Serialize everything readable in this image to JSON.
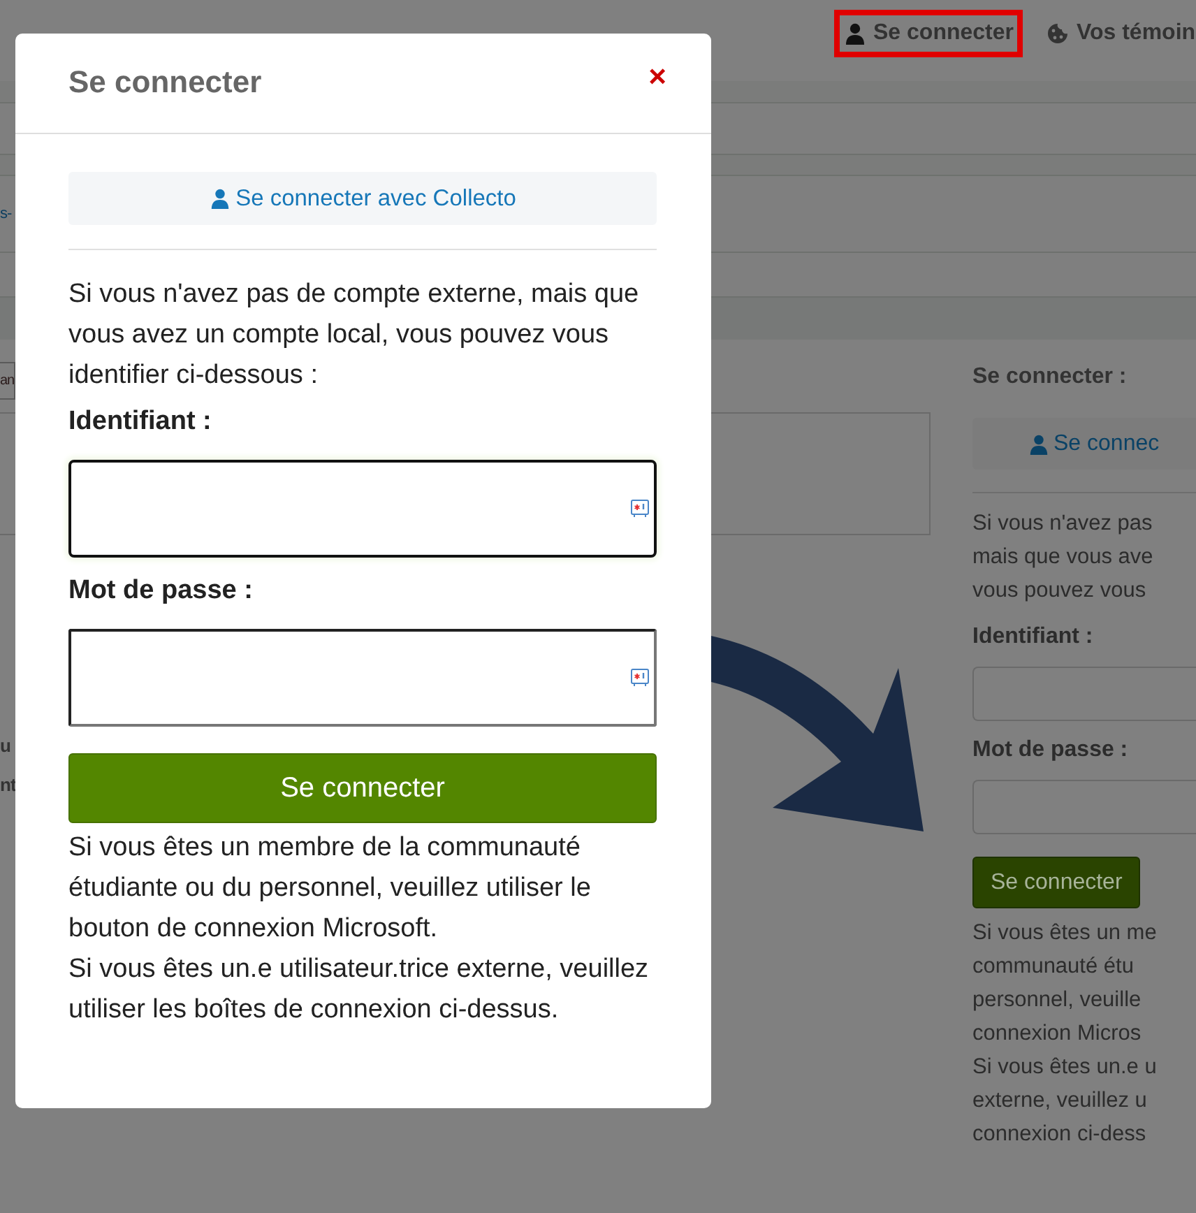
{
  "header": {
    "links": [
      {
        "label": "Se connecter",
        "kind": "account",
        "highlighted": true
      },
      {
        "label": "Vos témoin",
        "kind": "cookies",
        "highlighted": false
      }
    ]
  },
  "background": {
    "fragments": [
      "s-",
      "an",
      "u",
      "nt"
    ]
  },
  "sidebar": {
    "title": "Se connecter :",
    "sso_button": "Se connec",
    "intro_lines": [
      "Si vous n'avez pas",
      "mais que vous ave",
      "vous pouvez vous"
    ],
    "fields": [
      {
        "label": "Identifiant :"
      },
      {
        "label": "Mot de passe :"
      }
    ],
    "submit": "Se connecter",
    "help_lines": [
      "Si vous êtes un me",
      "communauté étu",
      "personnel, veuille",
      "connexion Micros",
      "Si vous êtes un.e u",
      "externe, veuillez u",
      "connexion ci-dess"
    ]
  },
  "modal": {
    "title": "Se connecter",
    "close": "×",
    "sso_button": "Se connecter avec Collecto",
    "intro": "Si vous n'avez pas de compte externe, mais que vous avez un compte local, vous pouvez vous identifier ci-dessous :",
    "fields": [
      {
        "label": "Identifiant :",
        "focused": true
      },
      {
        "label": "Mot de passe :",
        "focused": false
      }
    ],
    "submit": "Se connecter",
    "help": [
      "Si vous êtes un membre de la communauté étudiante ou du personnel, veuillez utiliser le bouton de connexion Microsoft.",
      "Si vous êtes un.e utilisateur.trice externe, veuillez utiliser les boîtes de connexion ci-dessus."
    ]
  }
}
